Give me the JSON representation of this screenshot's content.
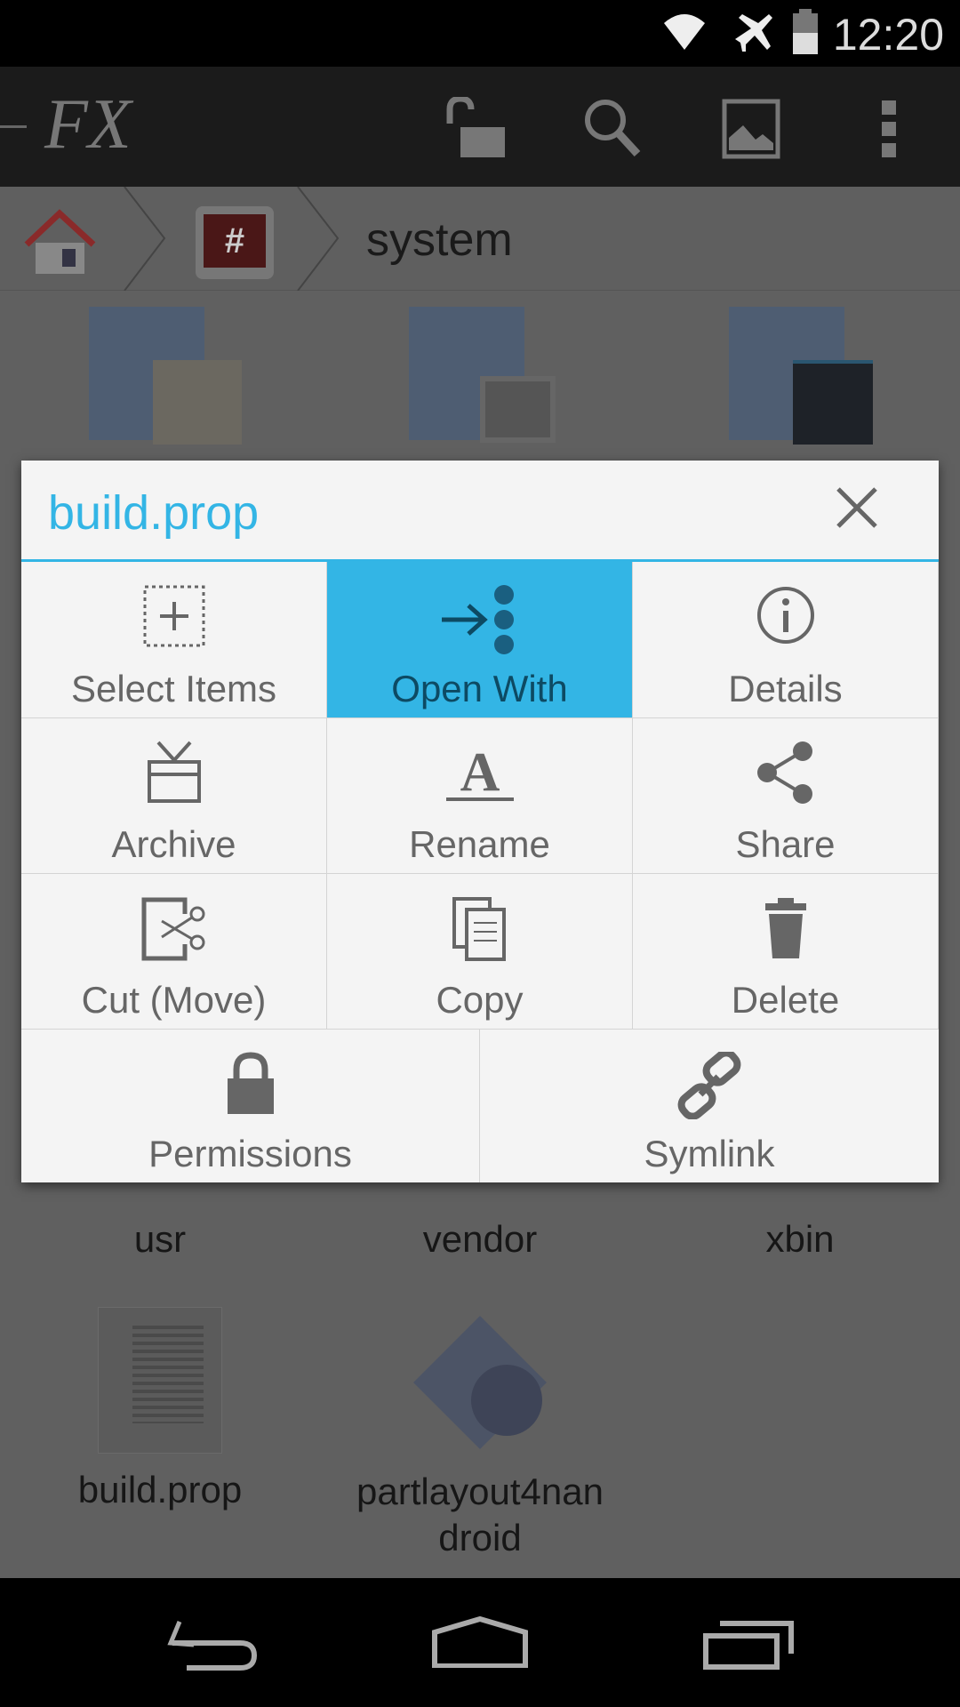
{
  "status_bar": {
    "time": "12:20",
    "icons": [
      "wifi-icon",
      "airplane-mode-icon",
      "battery-icon"
    ]
  },
  "toolbar": {
    "logo": "FX",
    "icons": [
      "unlock-icon",
      "search-icon",
      "image-icon",
      "overflow-menu-icon"
    ]
  },
  "breadcrumb": {
    "items": [
      "home",
      "root",
      "system"
    ],
    "current": "system"
  },
  "files": [
    {
      "name": "usr"
    },
    {
      "name": "vendor"
    },
    {
      "name": "xbin"
    },
    {
      "name": "build.prop"
    },
    {
      "name": "partlayout4nan\ndroid",
      "line1": "partlayout4nan",
      "line2": "droid"
    }
  ],
  "dialog": {
    "title": "build.prop",
    "accent": "#33b5e5",
    "actions": [
      {
        "label": "Select Items",
        "icon": "select-icon"
      },
      {
        "label": "Open With",
        "icon": "open-with-icon",
        "highlighted": true
      },
      {
        "label": "Details",
        "icon": "info-icon"
      },
      {
        "label": "Archive",
        "icon": "archive-icon"
      },
      {
        "label": "Rename",
        "icon": "rename-icon"
      },
      {
        "label": "Share",
        "icon": "share-icon"
      },
      {
        "label": "Cut (Move)",
        "icon": "cut-icon"
      },
      {
        "label": "Copy",
        "icon": "copy-icon"
      },
      {
        "label": "Delete",
        "icon": "delete-icon"
      },
      {
        "label": "Permissions",
        "icon": "lock-icon"
      },
      {
        "label": "Symlink",
        "icon": "link-icon"
      }
    ]
  }
}
